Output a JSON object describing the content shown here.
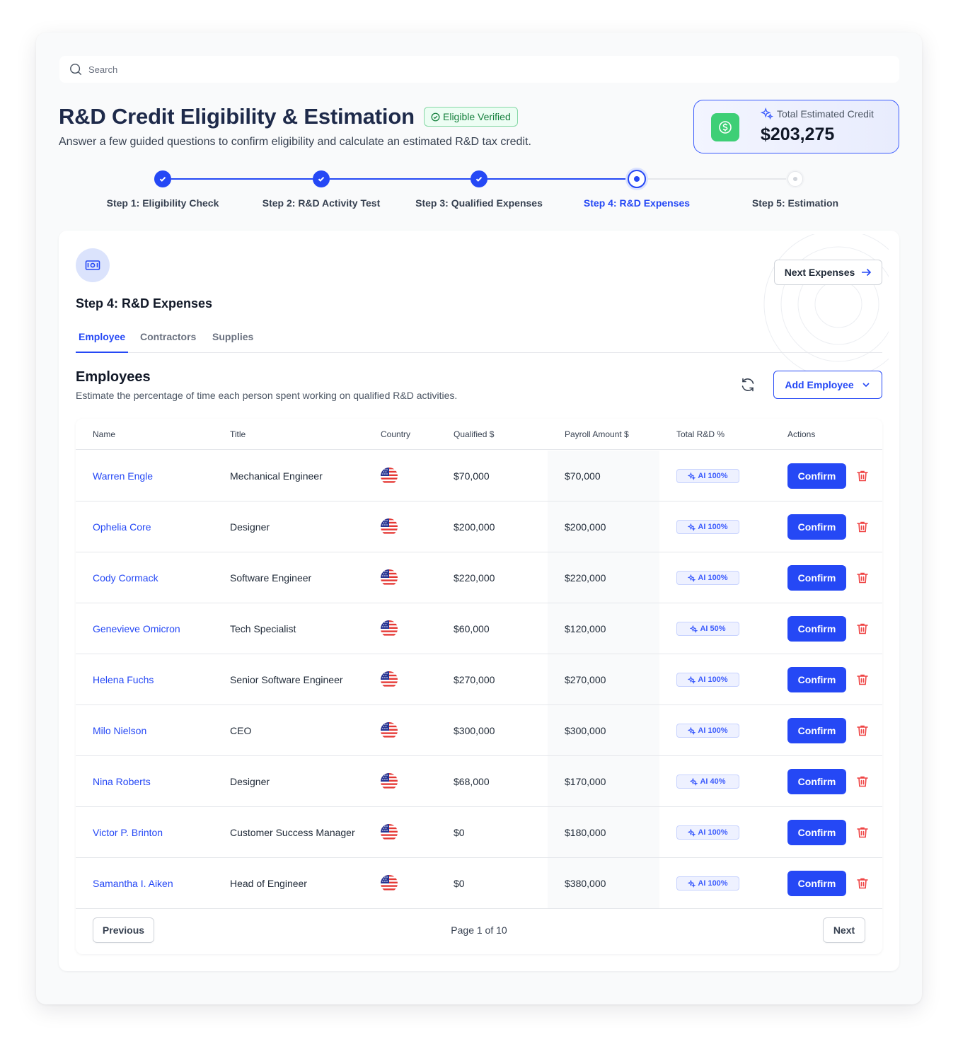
{
  "search": {
    "placeholder": "Search"
  },
  "header": {
    "title": "R&D Credit Eligibility & Estimation",
    "badge": "Eligible Verified",
    "subtitle": "Answer a few guided questions to confirm eligibility and calculate an estimated R&D tax credit."
  },
  "credit": {
    "label": "Total Estimated Credit",
    "value": "$203,275"
  },
  "steps": [
    {
      "label": "Step 1: Eligibility Check",
      "state": "done"
    },
    {
      "label": "Step 2: R&D Activity Test",
      "state": "done"
    },
    {
      "label": "Step 3: Qualified Expenses",
      "state": "done"
    },
    {
      "label": "Step 4: R&D Expenses",
      "state": "current"
    },
    {
      "label": "Step 5: Estimation",
      "state": "todo"
    }
  ],
  "card": {
    "title": "Step 4: R&D Expenses",
    "next_button": "Next Expenses",
    "tabs": [
      "Employee",
      "Contractors",
      "Supplies"
    ],
    "active_tab": "Employee"
  },
  "employees": {
    "title": "Employees",
    "subtitle": "Estimate the percentage of time each person spent working on qualified R&D activities.",
    "add_button": "Add Employee"
  },
  "table": {
    "columns": [
      "Name",
      "Title",
      "Country",
      "Qualified $",
      "Payroll Amount $",
      "Total R&D %",
      "Actions"
    ],
    "rows": [
      {
        "name": "Warren Engle",
        "title": "Mechanical Engineer",
        "country": "us-flag",
        "qualified": "$70,000",
        "payroll": "$70,000",
        "rd": "AI 100%",
        "action": "Confirm"
      },
      {
        "name": "Ophelia Core",
        "title": "Designer",
        "country": "us-flag",
        "qualified": "$200,000",
        "payroll": "$200,000",
        "rd": "AI 100%",
        "action": "Confirm"
      },
      {
        "name": "Cody Cormack",
        "title": "Software Engineer",
        "country": "us-flag",
        "qualified": "$220,000",
        "payroll": "$220,000",
        "rd": "AI 100%",
        "action": "Confirm"
      },
      {
        "name": "Genevieve Omicron",
        "title": "Tech Specialist",
        "country": "us-flag",
        "qualified": "$60,000",
        "payroll": "$120,000",
        "rd": "AI 50%",
        "action": "Confirm"
      },
      {
        "name": "Helena Fuchs",
        "title": "Senior Software Engineer",
        "country": "us-flag",
        "qualified": "$270,000",
        "payroll": "$270,000",
        "rd": "AI 100%",
        "action": "Confirm"
      },
      {
        "name": "Milo Nielson",
        "title": "CEO",
        "country": "us-flag",
        "qualified": "$300,000",
        "payroll": "$300,000",
        "rd": "AI 100%",
        "action": "Confirm"
      },
      {
        "name": "Nina Roberts",
        "title": "Designer",
        "country": "us-flag",
        "qualified": "$68,000",
        "payroll": "$170,000",
        "rd": "AI 40%",
        "action": "Confirm"
      },
      {
        "name": "Victor P. Brinton",
        "title": "Customer Success Manager",
        "country": "us-flag",
        "qualified": "$0",
        "payroll": "$180,000",
        "rd": "AI 100%",
        "action": "Confirm"
      },
      {
        "name": "Samantha I. Aiken",
        "title": "Head of Engineer",
        "country": "us-flag",
        "qualified": "$0",
        "payroll": "$380,000",
        "rd": "AI 100%",
        "action": "Confirm"
      }
    ]
  },
  "pagination": {
    "previous": "Previous",
    "info": "Page 1 of 10",
    "next": "Next"
  },
  "colors": {
    "primary": "#2548f5",
    "success": "#3ecf76",
    "danger": "#ef4444"
  }
}
